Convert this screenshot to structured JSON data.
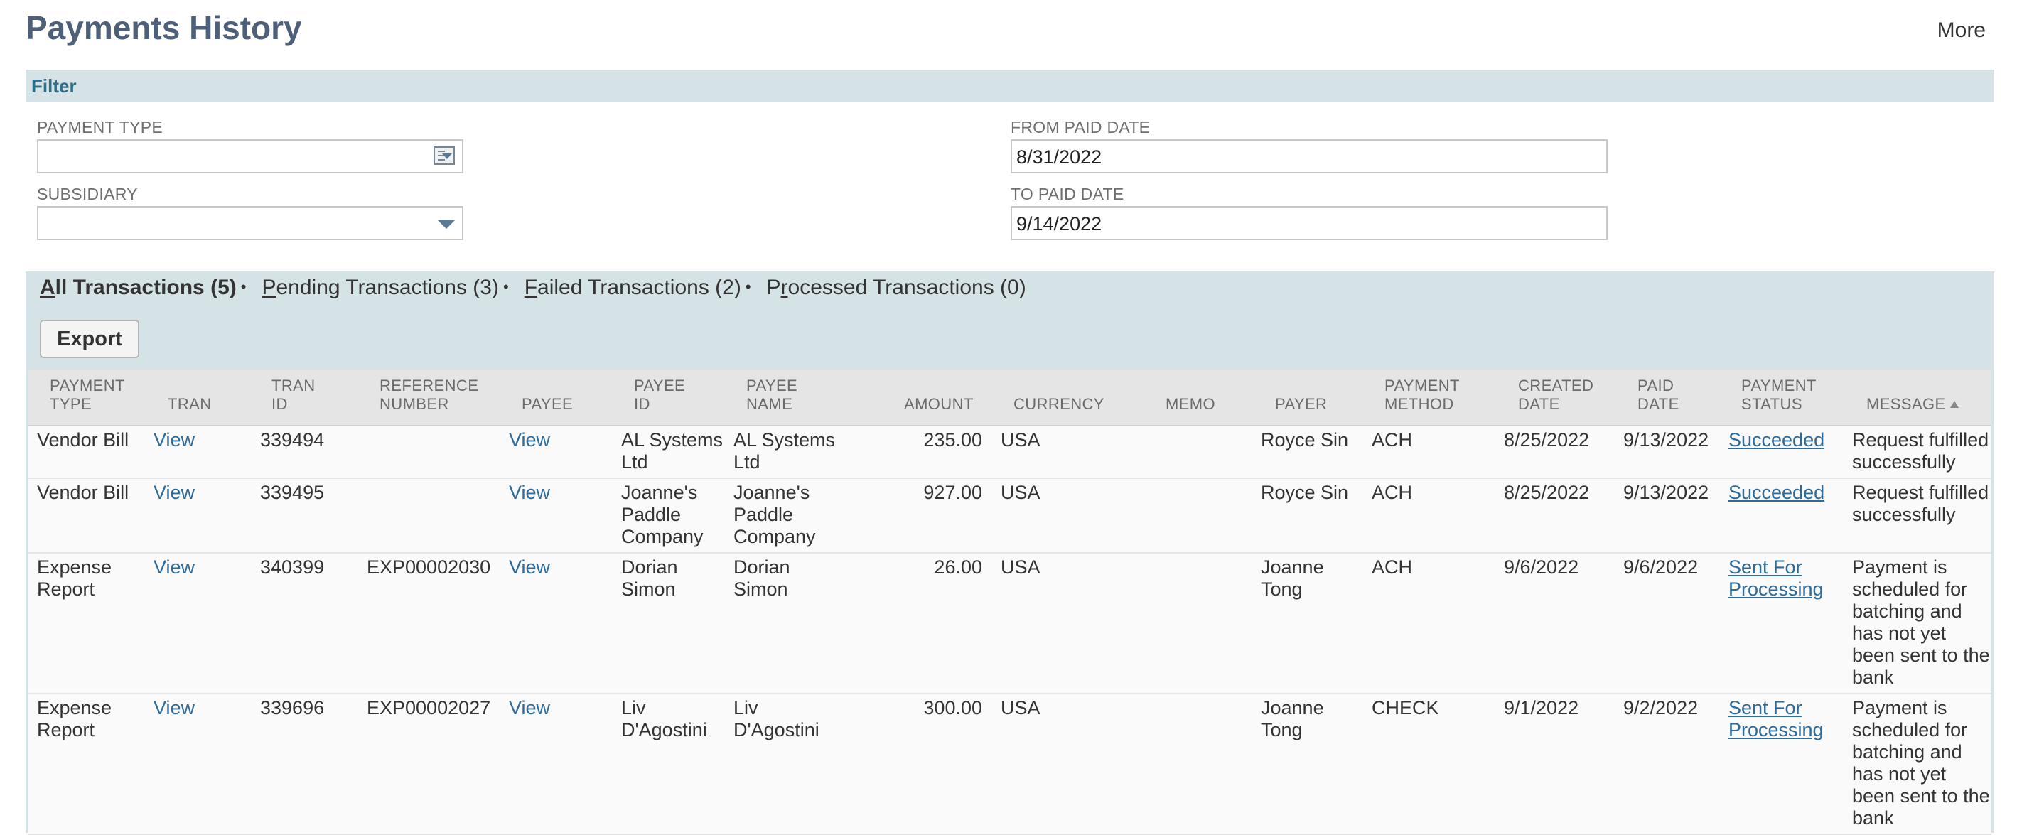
{
  "page": {
    "title": "Payments History",
    "more": "More"
  },
  "filter": {
    "title": "Filter",
    "payment_type": {
      "label": "PAYMENT TYPE",
      "value": ""
    },
    "subsidiary": {
      "label": "SUBSIDIARY",
      "value": ""
    },
    "from_paid_date": {
      "label": "FROM PAID DATE",
      "value": "8/31/2022"
    },
    "to_paid_date": {
      "label": "TO PAID DATE",
      "value": "9/14/2022"
    }
  },
  "tabs": [
    {
      "key": "A",
      "rest": "ll Transactions (5)"
    },
    {
      "key": "P",
      "rest": "ending Transactions (3)"
    },
    {
      "key": "F",
      "rest": "ailed Transactions (2)"
    },
    {
      "pre": "P",
      "key": "r",
      "rest": "ocessed Transactions (0)"
    }
  ],
  "tab_separator": "•",
  "export_label": "Export",
  "columns": {
    "payment_type": [
      "PAYMENT",
      "TYPE"
    ],
    "tran": [
      "",
      "TRAN"
    ],
    "tran_id": [
      "TRAN",
      "ID"
    ],
    "reference_number": [
      "REFERENCE",
      "NUMBER"
    ],
    "payee": [
      "",
      "PAYEE"
    ],
    "payee_id": [
      "PAYEE",
      "ID"
    ],
    "payee_name": [
      "PAYEE",
      "NAME"
    ],
    "amount": [
      "",
      "AMOUNT"
    ],
    "currency": [
      "",
      "CURRENCY"
    ],
    "memo": [
      "",
      "MEMO"
    ],
    "payer": [
      "",
      "PAYER"
    ],
    "payment_method": [
      "PAYMENT",
      "METHOD"
    ],
    "created_date": [
      "CREATED",
      "DATE"
    ],
    "paid_date": [
      "PAID",
      "DATE"
    ],
    "payment_status": [
      "PAYMENT",
      "STATUS"
    ],
    "message": [
      "",
      "MESSAGE"
    ]
  },
  "rows": [
    {
      "payment_type": [
        "Vendor Bill"
      ],
      "tran": "View",
      "tran_id": "339494",
      "reference_number": "",
      "payee": "View",
      "payee_id": [
        "AL Systems",
        "Ltd"
      ],
      "payee_name": [
        "AL Systems",
        "Ltd"
      ],
      "amount": "235.00",
      "currency": "USA",
      "memo": "",
      "payer": [
        "Royce Sin"
      ],
      "payment_method": "ACH",
      "created_date": "8/25/2022",
      "paid_date": "9/13/2022",
      "payment_status": [
        "Succeeded"
      ],
      "message": [
        "Request fulfilled",
        "successfully"
      ]
    },
    {
      "payment_type": [
        "Vendor Bill"
      ],
      "tran": "View",
      "tran_id": "339495",
      "reference_number": "",
      "payee": "View",
      "payee_id": [
        "Joanne's",
        "Paddle",
        "Company"
      ],
      "payee_name": [
        "Joanne's",
        "Paddle",
        "Company"
      ],
      "amount": "927.00",
      "currency": "USA",
      "memo": "",
      "payer": [
        "Royce Sin"
      ],
      "payment_method": "ACH",
      "created_date": "8/25/2022",
      "paid_date": "9/13/2022",
      "payment_status": [
        "Succeeded"
      ],
      "message": [
        "Request fulfilled",
        "successfully"
      ]
    },
    {
      "payment_type": [
        "Expense",
        "Report"
      ],
      "tran": "View",
      "tran_id": "340399",
      "reference_number": "EXP00002030",
      "payee": "View",
      "payee_id": [
        "Dorian",
        "Simon"
      ],
      "payee_name": [
        "Dorian",
        "Simon"
      ],
      "amount": "26.00",
      "currency": "USA",
      "memo": "",
      "payer": [
        "Joanne",
        "Tong"
      ],
      "payment_method": "ACH",
      "created_date": "9/6/2022",
      "paid_date": "9/6/2022",
      "payment_status": [
        "Sent For",
        "Processing"
      ],
      "message": [
        "Payment is",
        "scheduled for",
        "batching and",
        "has not yet",
        "been sent to the",
        "bank"
      ]
    },
    {
      "payment_type": [
        "Expense",
        "Report"
      ],
      "tran": "View",
      "tran_id": "339696",
      "reference_number": "EXP00002027",
      "payee": "View",
      "payee_id": [
        "Liv",
        "D'Agostini"
      ],
      "payee_name": [
        "Liv",
        "D'Agostini"
      ],
      "amount": "300.00",
      "currency": "USA",
      "memo": "",
      "payer": [
        "Joanne",
        "Tong"
      ],
      "payment_method": "CHECK",
      "created_date": "9/1/2022",
      "paid_date": "9/2/2022",
      "payment_status": [
        "Sent For",
        "Processing"
      ],
      "message": [
        "Payment is",
        "scheduled for",
        "batching and",
        "has not yet",
        "been sent to the",
        "bank"
      ]
    }
  ]
}
